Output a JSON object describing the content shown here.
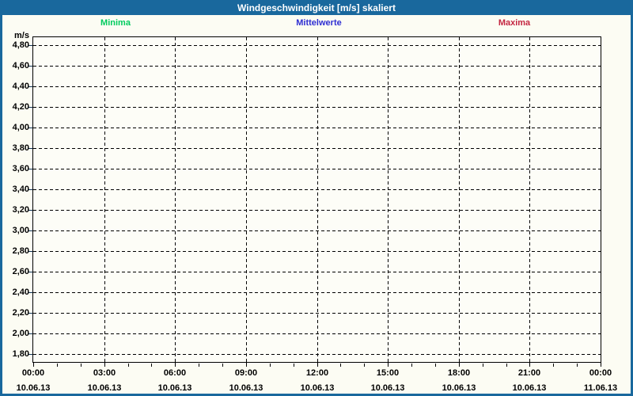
{
  "title": "Windgeschwindigkeit [m/s] skaliert",
  "colors": {
    "titlebar_bg": "#19689d",
    "titlebar_text": "#ffffff",
    "frame_border": "#19689d",
    "background": "#fcfcf3",
    "grid": "#000000",
    "minima": "#00cb5e",
    "mittelwerte": "#2e2ed2",
    "maxima": "#c42641"
  },
  "legend": {
    "items": [
      {
        "label": "Minima",
        "color": "#00cb5e",
        "center_x_frac": 0.146
      },
      {
        "label": "Mittelwerte",
        "color": "#2e2ed2",
        "center_x_frac": 0.503
      },
      {
        "label": "Maxima",
        "color": "#c42641",
        "center_x_frac": 0.847
      }
    ]
  },
  "chart_data": {
    "type": "line",
    "title": "Windgeschwindigkeit [m/s] skaliert",
    "unit_label": "m/s",
    "grid": "dashed",
    "legend_position": "top",
    "y_ticks": [
      "4,80",
      "4,60",
      "4,40",
      "4,20",
      "4,00",
      "3,80",
      "3,60",
      "3,40",
      "3,20",
      "3,00",
      "2,80",
      "2,60",
      "2,40",
      "2,20",
      "2,00",
      "1,80"
    ],
    "y_max_label": 4.8,
    "y_min_label": 1.8,
    "y_step": 0.2,
    "x_ticks": [
      {
        "time": "00:00",
        "date": "10.06.13"
      },
      {
        "time": "03:00",
        "date": "10.06.13"
      },
      {
        "time": "06:00",
        "date": "10.06.13"
      },
      {
        "time": "09:00",
        "date": "10.06.13"
      },
      {
        "time": "12:00",
        "date": "10.06.13"
      },
      {
        "time": "15:00",
        "date": "10.06.13"
      },
      {
        "time": "18:00",
        "date": "10.06.13"
      },
      {
        "time": "21:00",
        "date": "10.06.13"
      },
      {
        "time": "00:00",
        "date": "11.06.13"
      }
    ],
    "x_major_interval_hours": 3,
    "x_minor_interval_hours": 1,
    "series": [
      {
        "name": "Minima",
        "color": "#00cb5e",
        "values": []
      },
      {
        "name": "Mittelwerte",
        "color": "#2e2ed2",
        "values": []
      },
      {
        "name": "Maxima",
        "color": "#c42641",
        "values": []
      }
    ]
  }
}
